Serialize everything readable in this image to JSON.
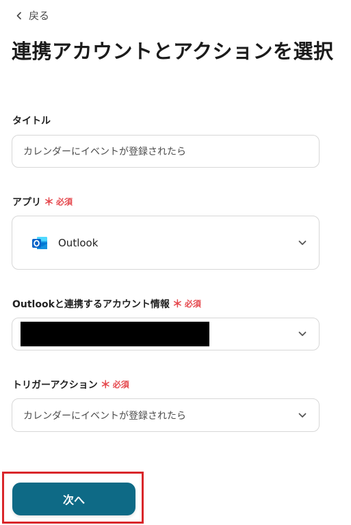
{
  "nav": {
    "back_label": "戻る"
  },
  "page_title": "連携アカウントとアクションを選択",
  "form": {
    "title_field": {
      "label": "タイトル",
      "value": "カレンダーにイベントが登録されたら"
    },
    "app_field": {
      "label": "アプリ",
      "required_mark": "＊",
      "required_text": "必須",
      "value": "Outlook",
      "icon": "outlook-icon"
    },
    "account_field": {
      "label": "Outlookと連携するアカウント情報",
      "required_mark": "＊",
      "required_text": "必須"
    },
    "trigger_field": {
      "label": "トリガーアクション",
      "required_mark": "＊",
      "required_text": "必須",
      "value": "カレンダーにイベントが登録されたら"
    }
  },
  "next_button": {
    "label": "次へ"
  },
  "colors": {
    "primary": "#0e6a86",
    "required": "#e5484d",
    "highlight": "#d9262a",
    "outlook_blue": "#0a64c8"
  }
}
